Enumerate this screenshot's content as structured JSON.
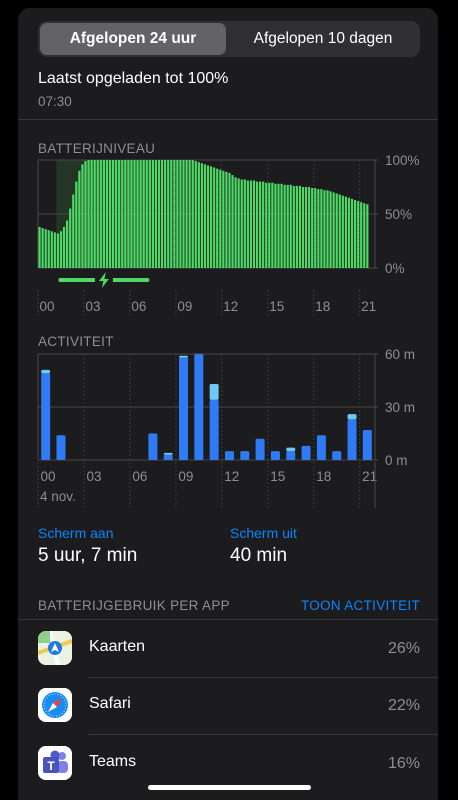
{
  "tabs": {
    "active": "Afgelopen 24 uur",
    "other": "Afgelopen 10 dagen"
  },
  "last_charge": {
    "title": "Laatst opgeladen tot 100%",
    "time": "07:30"
  },
  "battery_chart": {
    "label": "BATTERIJNIVEAU",
    "y_ticks": [
      "100%",
      "50%",
      "0%"
    ],
    "x_ticks": [
      "00",
      "03",
      "06",
      "09",
      "12",
      "15",
      "18",
      "21"
    ]
  },
  "activity_chart": {
    "label": "ACTIVITEIT",
    "y_ticks": [
      "60 m",
      "30 m",
      "0 m"
    ],
    "x_ticks": [
      "00",
      "03",
      "06",
      "09",
      "12",
      "15",
      "18",
      "21"
    ],
    "date": "4 nov."
  },
  "screen": {
    "on_label": "Scherm aan",
    "on_value": "5 uur, 7 min",
    "off_label": "Scherm uit",
    "off_value": "40 min"
  },
  "usage": {
    "header": "BATTERIJGEBRUIK PER APP",
    "action": "TOON ACTIVITEIT",
    "apps": [
      {
        "name": "Kaarten",
        "pct": "26%",
        "icon": "maps-icon"
      },
      {
        "name": "Safari",
        "pct": "22%",
        "icon": "safari-icon"
      },
      {
        "name": "Teams",
        "pct": "16%",
        "icon": "teams-icon"
      }
    ]
  },
  "colors": {
    "accent": "#0a84ff",
    "battery": "#4cd964",
    "activity_on": "#2f7bf5",
    "activity_off": "#6ec6f5"
  },
  "chart_data": [
    {
      "type": "bar",
      "title": "BATTERIJNIVEAU",
      "ylim": [
        0,
        100
      ],
      "x_range": [
        0,
        22
      ],
      "charging": {
        "start": 1.2,
        "end": 7.4
      },
      "x": [
        0.1,
        0.3,
        0.5,
        0.7,
        0.9,
        1.1,
        1.3,
        1.5,
        1.7,
        1.9,
        2.1,
        2.3,
        2.5,
        2.7,
        2.9,
        3.1,
        3.3,
        3.5,
        3.7,
        3.9,
        4.1,
        4.3,
        4.5,
        4.7,
        4.9,
        5.1,
        5.3,
        5.5,
        5.7,
        5.9,
        6.1,
        6.3,
        6.5,
        6.7,
        6.9,
        7.1,
        7.3,
        7.5,
        7.7,
        7.9,
        8.1,
        8.3,
        8.5,
        8.7,
        8.9,
        9.1,
        9.3,
        9.5,
        9.7,
        9.9,
        10.1,
        10.3,
        10.5,
        10.7,
        10.9,
        11.1,
        11.3,
        11.5,
        11.7,
        11.9,
        12.1,
        12.3,
        12.5,
        12.7,
        12.9,
        13.1,
        13.3,
        13.5,
        13.7,
        13.9,
        14.1,
        14.3,
        14.5,
        14.7,
        14.9,
        15.1,
        15.3,
        15.5,
        15.7,
        15.9,
        16.1,
        16.3,
        16.5,
        16.7,
        16.9,
        17.1,
        17.3,
        17.5,
        17.7,
        17.9,
        18.1,
        18.3,
        18.5,
        18.7,
        18.9,
        19.1,
        19.3,
        19.5,
        19.7,
        19.9,
        20.1,
        20.3,
        20.5,
        20.7,
        20.9,
        21.1,
        21.3,
        21.5
      ],
      "values": [
        38,
        37,
        36,
        35,
        34,
        33,
        32,
        34,
        38,
        44,
        55,
        68,
        80,
        90,
        96,
        99,
        100,
        100,
        100,
        100,
        100,
        100,
        100,
        100,
        100,
        100,
        100,
        100,
        100,
        100,
        100,
        100,
        100,
        100,
        100,
        100,
        100,
        100,
        100,
        100,
        100,
        100,
        100,
        100,
        100,
        100,
        100,
        100,
        100,
        100,
        100,
        99,
        98,
        97,
        96,
        95,
        94,
        93,
        92,
        91,
        90,
        89,
        88,
        86,
        84,
        83,
        82,
        82,
        81,
        81,
        81,
        80,
        80,
        80,
        79,
        79,
        79,
        78,
        78,
        78,
        77,
        77,
        77,
        76,
        76,
        76,
        75,
        75,
        75,
        74,
        74,
        73,
        73,
        72,
        72,
        71,
        70,
        69,
        68,
        67,
        66,
        65,
        64,
        63,
        62,
        61,
        60,
        59
      ]
    },
    {
      "type": "bar",
      "title": "ACTIVITEIT",
      "ylim": [
        0,
        60
      ],
      "categories": [
        "00",
        "01",
        "02",
        "03",
        "04",
        "05",
        "06",
        "07",
        "08",
        "09",
        "10",
        "11",
        "12",
        "13",
        "14",
        "15",
        "16",
        "17",
        "18",
        "19",
        "20",
        "21"
      ],
      "series": [
        {
          "name": "Scherm aan",
          "values": [
            49,
            14,
            0,
            0,
            0,
            0,
            0,
            15,
            3,
            58,
            60,
            34,
            5,
            5,
            12,
            5,
            5,
            8,
            14,
            5,
            23,
            17
          ]
        },
        {
          "name": "Scherm uit",
          "values": [
            2,
            0,
            0,
            0,
            0,
            0,
            0,
            0,
            1,
            1,
            0,
            9,
            0,
            0,
            0,
            0,
            2,
            0,
            0,
            0,
            3,
            0
          ]
        }
      ]
    }
  ]
}
